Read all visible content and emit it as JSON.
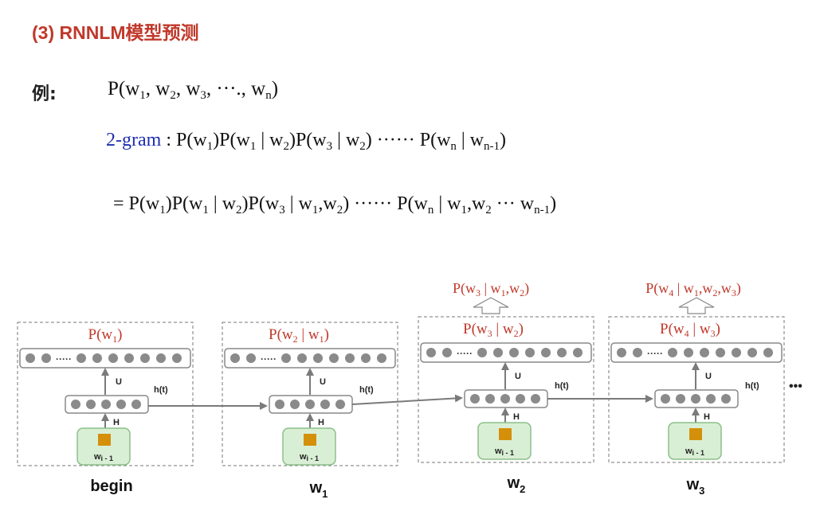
{
  "title": "(3) RNNLM模型预测",
  "example_label": "例:",
  "example_formula": {
    "p": "P(w",
    "sub1": "1",
    "mid1": ", w",
    "sub2": "2",
    "mid2": ", w",
    "sub3": "3",
    "mid3": ", ···., w",
    "subn": "n",
    "end": ")"
  },
  "bigram": {
    "label": "2-gram",
    "colon": " : ",
    "parts": [
      "P(w",
      "1",
      ")P(w",
      "1",
      " | w",
      "2",
      ")P(w",
      "3",
      " | w",
      "2",
      ")  ······  P(w",
      "n",
      " |  w",
      "n-1",
      ")"
    ]
  },
  "rnn_eq": {
    "parts": [
      "= P(w",
      "1",
      ")P(w",
      "1",
      " | w",
      "2",
      ")P(w",
      "3",
      " | w",
      "1",
      ",w",
      "2",
      ")  ······  P(w",
      "n",
      " | w",
      "1",
      ",w",
      "2",
      " ··· w",
      "n-1",
      ")"
    ]
  },
  "diagram": {
    "columns": [
      {
        "output_prob": {
          "p": "P(w",
          "a": "1",
          "b": "",
          "c": "",
          "end": ")"
        },
        "top_prob": null,
        "word": "begin",
        "word_sub": ""
      },
      {
        "output_prob": {
          "p": "P(w",
          "a": "2",
          "b": " | w",
          "c": "1",
          "end": ")"
        },
        "top_prob": null,
        "word": "w",
        "word_sub": "1"
      },
      {
        "output_prob": {
          "p": "P(w",
          "a": "3",
          "b": " | w",
          "c": "2",
          "end": ")"
        },
        "top_prob": {
          "parts": [
            "P(w",
            "3",
            " | w",
            "1",
            ",w",
            "2",
            ")"
          ]
        },
        "word": "w",
        "word_sub": "2"
      },
      {
        "output_prob": {
          "p": "P(w",
          "a": "4",
          "b": " | w",
          "c": "3",
          "end": ")"
        },
        "top_prob": {
          "parts": [
            "P(w",
            "4",
            " | w",
            "1",
            ",w",
            "2",
            ",w",
            "3",
            ")"
          ]
        },
        "word": "w",
        "word_sub": "3"
      }
    ],
    "labels": {
      "u": "U",
      "h": "H",
      "ht": "h(t)",
      "input": "w",
      "input_sub": "i - 1",
      "dots": "·····",
      "ellipsis": "•••"
    },
    "colors": {
      "red": "#c0392b",
      "node": "#8a8a8a",
      "input_fill": "#d9efd5",
      "input_border": "#8cc08a",
      "orange": "#d4900a",
      "arrow": "#7a7a7a"
    }
  }
}
